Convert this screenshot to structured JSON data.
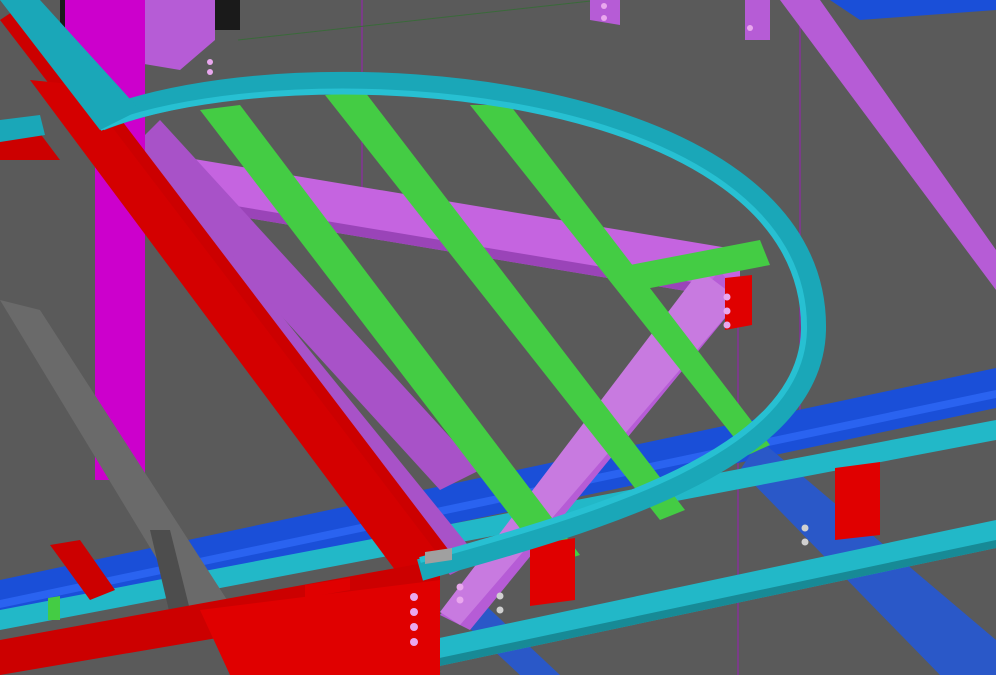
{
  "viewport": {
    "background": "#5a5a5a",
    "colors": {
      "red_beam": "#cc0000",
      "red_plate": "#e00000",
      "cyan_curved_beam": "#1aa7b8",
      "cyan_beam": "#22b8c8",
      "green_beam": "#44cc44",
      "purple_beam": "#b65cd6",
      "magenta_column": "#cc00cc",
      "blue_beam": "#1a4fd8",
      "gray_beam": "#5f5f5f",
      "bolt": "#e9a7ee",
      "grid_line": "#a020c0"
    }
  }
}
